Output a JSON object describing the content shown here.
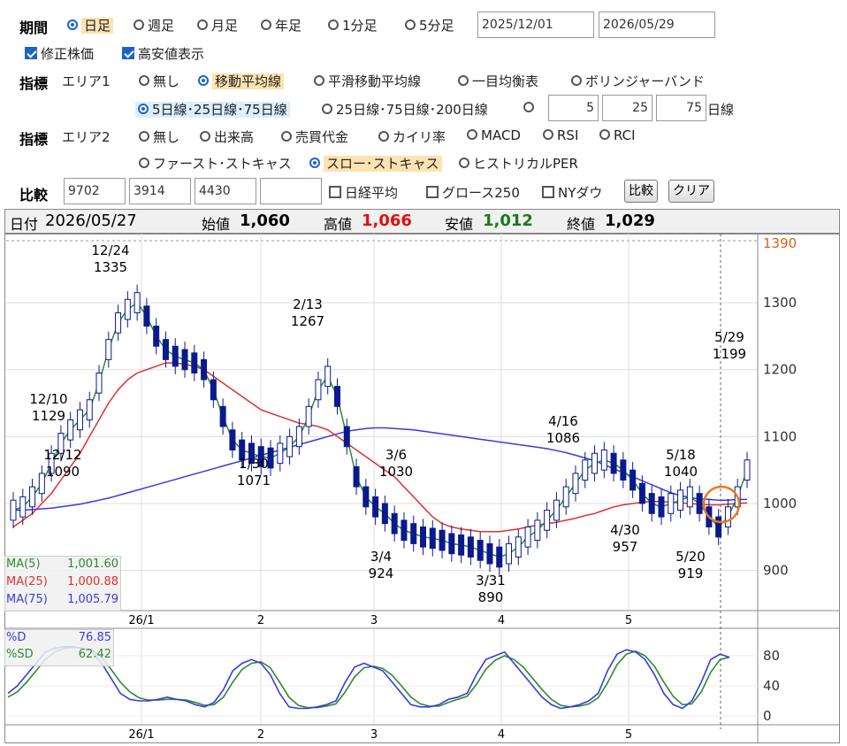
{
  "period": {
    "label": "期間",
    "options": [
      {
        "label": "日足",
        "selected": true
      },
      {
        "label": "週足",
        "selected": false
      },
      {
        "label": "月足",
        "selected": false
      },
      {
        "label": "年足",
        "selected": false
      },
      {
        "label": "1分足",
        "selected": false
      },
      {
        "label": "5分足",
        "selected": false
      }
    ],
    "start_date": "2025/12/01",
    "end_date": "2026/05/29"
  },
  "checks": {
    "adjusted": "修正株価",
    "highlow": "高安値表示"
  },
  "indicator1": {
    "label": "指標",
    "area": "エリア1",
    "options": [
      "無し",
      "移動平均線",
      "平滑移動平均線",
      "一目均衡表",
      "ボリンジャーバンド"
    ],
    "selected": "移動平均線",
    "ma_options": [
      "5日線･25日線･75日線",
      "25日線･75日線･200日線"
    ],
    "ma_custom": [
      "5",
      "25",
      "75"
    ],
    "ma_unit": "日線"
  },
  "indicator2": {
    "label": "指標",
    "area": "エリア2",
    "options_row1": [
      "無し",
      "出来高",
      "売買代金",
      "カイリ率",
      "MACD",
      "RSI",
      "RCI"
    ],
    "options_row2": [
      "ファースト･ストキャス",
      "スロー･ストキャス",
      "ヒストリカルPER"
    ],
    "selected": "スロー･ストキャス"
  },
  "compare": {
    "label": "比較",
    "codes": [
      "9702",
      "3914",
      "4430",
      ""
    ],
    "checks": [
      "日経平均",
      "グロース250",
      "NYダウ"
    ],
    "compare_button": "比較",
    "clear_button": "クリア"
  },
  "ohlc": {
    "date_label": "日付",
    "date": "2026/05/27",
    "open_label": "始値",
    "open": "1,060",
    "high_label": "高値",
    "high": "1,066",
    "low_label": "安値",
    "low": "1,012",
    "close_label": "終値",
    "close": "1,029"
  },
  "colors": {
    "ma5": "#2e8b2e",
    "ma25": "#e03030",
    "ma75": "#3a3ae0",
    "candle": "#0a1a8c",
    "highlight": "#e87b1e"
  },
  "chart_data": {
    "type": "candlestick",
    "ylim": [
      840,
      1390
    ],
    "yticks": [
      "1390",
      "1300",
      "1200",
      "1100",
      "1000",
      "900"
    ],
    "xticks": [
      "26/1",
      "2",
      "3",
      "4",
      "5"
    ],
    "annotations": [
      {
        "date": "12/24",
        "value": "1335"
      },
      {
        "date": "12/10",
        "value": "1129"
      },
      {
        "date": "12/12",
        "value": "1090"
      },
      {
        "date": "1/30",
        "value": "1071"
      },
      {
        "date": "2/13",
        "value": "1267"
      },
      {
        "date": "3/6",
        "value": "1030"
      },
      {
        "date": "3/4",
        "value": "924"
      },
      {
        "date": "3/31",
        "value": "890"
      },
      {
        "date": "4/16",
        "value": "1086"
      },
      {
        "date": "4/30",
        "value": "957"
      },
      {
        "date": "5/18",
        "value": "1040"
      },
      {
        "date": "5/20",
        "value": "919"
      },
      {
        "date": "5/29",
        "value": "1199"
      }
    ],
    "legend": [
      {
        "name": "MA(5)",
        "value": "1,001.60"
      },
      {
        "name": "MA(25)",
        "value": "1,000.88"
      },
      {
        "name": "MA(75)",
        "value": "1,005.79"
      }
    ],
    "ma5": [
      990,
      995,
      1010,
      1030,
      1060,
      1090,
      1110,
      1125,
      1140,
      1180,
      1230,
      1270,
      1290,
      1300,
      1280,
      1250,
      1230,
      1220,
      1215,
      1210,
      1200,
      1170,
      1130,
      1095,
      1080,
      1075,
      1070,
      1068,
      1075,
      1085,
      1100,
      1130,
      1170,
      1190,
      1160,
      1100,
      1040,
      1010,
      995,
      985,
      970,
      960,
      955,
      950,
      948,
      945,
      940,
      938,
      935,
      930,
      925,
      920,
      925,
      935,
      950,
      960,
      975,
      990,
      1010,
      1030,
      1050,
      1060,
      1065,
      1060,
      1050,
      1035,
      1015,
      1000,
      995,
      1000,
      1005,
      1010,
      1000,
      980,
      965,
      980,
      1010,
      1050
    ],
    "ma25": [
      965,
      975,
      985,
      1000,
      1015,
      1035,
      1055,
      1075,
      1100,
      1125,
      1150,
      1170,
      1185,
      1195,
      1200,
      1205,
      1210,
      1210,
      1208,
      1205,
      1200,
      1190,
      1180,
      1170,
      1160,
      1150,
      1140,
      1135,
      1130,
      1125,
      1120,
      1118,
      1115,
      1110,
      1100,
      1090,
      1080,
      1070,
      1060,
      1050,
      1040,
      1025,
      1010,
      995,
      980,
      970,
      965,
      962,
      960,
      958,
      958,
      958,
      960,
      962,
      965,
      968,
      970,
      972,
      975,
      978,
      982,
      985,
      990,
      995,
      998,
      1000,
      1002,
      1003,
      1003,
      1002,
      1001,
      1000,
      999,
      998,
      998,
      999,
      1000,
      1001
    ],
    "ma75": [
      990,
      990,
      991,
      992,
      993,
      995,
      997,
      999,
      1002,
      1005,
      1008,
      1012,
      1016,
      1020,
      1024,
      1028,
      1032,
      1036,
      1040,
      1044,
      1048,
      1052,
      1056,
      1060,
      1064,
      1068,
      1072,
      1076,
      1080,
      1084,
      1088,
      1092,
      1096,
      1100,
      1104,
      1108,
      1110,
      1112,
      1113,
      1113,
      1112,
      1111,
      1110,
      1108,
      1106,
      1104,
      1102,
      1100,
      1098,
      1096,
      1094,
      1092,
      1090,
      1088,
      1086,
      1084,
      1082,
      1079,
      1076,
      1072,
      1068,
      1064,
      1058,
      1052,
      1046,
      1040,
      1034,
      1028,
      1022,
      1016,
      1012,
      1009,
      1007,
      1006,
      1005,
      1005,
      1006,
      1006
    ],
    "stoch_d": [
      30,
      40,
      55,
      70,
      85,
      90,
      92,
      92,
      90,
      85,
      70,
      50,
      30,
      22,
      20,
      20,
      22,
      25,
      22,
      20,
      15,
      12,
      18,
      35,
      60,
      70,
      75,
      70,
      55,
      30,
      12,
      10,
      10,
      12,
      15,
      20,
      45,
      65,
      70,
      65,
      60,
      45,
      30,
      15,
      12,
      12,
      15,
      22,
      25,
      30,
      55,
      75,
      80,
      85,
      70,
      55,
      40,
      25,
      15,
      10,
      12,
      15,
      20,
      30,
      60,
      82,
      88,
      85,
      75,
      55,
      30,
      15,
      10,
      20,
      45,
      75,
      82,
      78
    ],
    "stoch_sd": [
      25,
      32,
      45,
      60,
      75,
      85,
      90,
      91,
      90,
      88,
      78,
      62,
      45,
      32,
      24,
      21,
      21,
      22,
      22,
      21,
      18,
      14,
      15,
      25,
      45,
      62,
      70,
      72,
      64,
      45,
      25,
      14,
      11,
      11,
      13,
      16,
      32,
      52,
      64,
      66,
      63,
      54,
      40,
      25,
      16,
      13,
      13,
      18,
      22,
      26,
      42,
      62,
      74,
      80,
      75,
      65,
      50,
      35,
      22,
      14,
      12,
      13,
      16,
      24,
      44,
      68,
      82,
      86,
      80,
      66,
      45,
      26,
      15,
      16,
      32,
      58,
      75,
      78
    ],
    "stoch_labels": [
      {
        "name": "%D",
        "value": "76.85"
      },
      {
        "name": "%SD",
        "value": "62.42"
      }
    ],
    "stoch_yticks": [
      "80",
      "40",
      "0"
    ]
  }
}
